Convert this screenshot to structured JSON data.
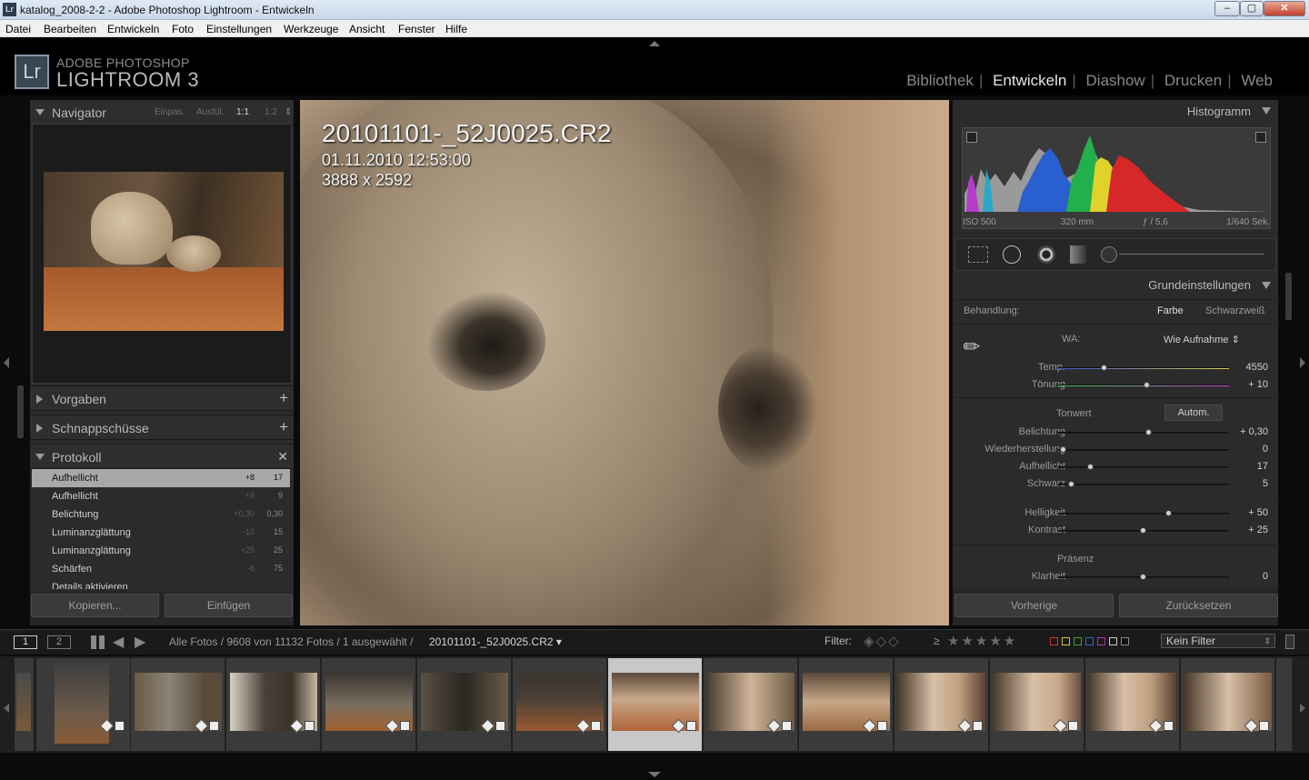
{
  "window": {
    "title": "katalog_2008-2-2 - Adobe Photoshop Lightroom - Entwickeln",
    "app_icon": "Lr"
  },
  "menu": [
    "Datei",
    "Bearbeiten",
    "Entwickeln",
    "Foto",
    "Einstellungen",
    "Werkzeuge",
    "Ansicht",
    "Fenster",
    "Hilfe"
  ],
  "brand": {
    "logo": "Lr",
    "line1": "ADOBE PHOTOSHOP",
    "line2": "LIGHTROOM 3"
  },
  "modules": [
    "Bibliothek",
    "Entwickeln",
    "Diashow",
    "Drucken",
    "Web"
  ],
  "active_module": "Entwickeln",
  "left": {
    "navigator": {
      "title": "Navigator",
      "zoom": [
        "Einpas.",
        "Ausfül.",
        "1:1",
        "1:2"
      ]
    },
    "vorgaben": "Vorgaben",
    "schnappschuesse": "Schnappschüsse",
    "protokoll": {
      "title": "Protokoll",
      "rows": [
        {
          "name": "Aufhellicht",
          "a": "+8",
          "b": "17"
        },
        {
          "name": "Aufhellicht",
          "a": "+9",
          "b": "9"
        },
        {
          "name": "Belichtung",
          "a": "+0,30",
          "b": "0,30"
        },
        {
          "name": "Luminanzglättung",
          "a": "-10",
          "b": "15"
        },
        {
          "name": "Luminanzglättung",
          "a": "+25",
          "b": "25"
        },
        {
          "name": "Schärfen",
          "a": "-6",
          "b": "75"
        },
        {
          "name": "Details aktivieren",
          "a": "",
          "b": ""
        }
      ]
    },
    "buttons": {
      "copy": "Kopieren...",
      "paste": "Einfügen"
    }
  },
  "photo": {
    "filename": "20101101-_52J0025.CR2",
    "datetime": "01.11.2010 12:53:00",
    "dims": "3888 x 2592"
  },
  "right": {
    "histogram": {
      "title": "Histogramm",
      "iso": "ISO 500",
      "focal": "320 mm",
      "aperture": "ƒ / 5,6",
      "shutter": "1/640 Sek."
    },
    "grund": "Grundeinstellungen",
    "behandlung": {
      "label": "Behandlung:",
      "farbe": "Farbe",
      "sw": "Schwarzweiß"
    },
    "wa": {
      "label": "WA:",
      "value": "Wie Aufnahme ⇕"
    },
    "temp": {
      "label": "Temp.",
      "value": "4550",
      "pos": 0.27
    },
    "toenung": {
      "label": "Tönung",
      "value": "+ 10",
      "pos": 0.52
    },
    "tonwert": {
      "label": "Tonwert",
      "auto": "Autom."
    },
    "belichtung": {
      "label": "Belichtung",
      "value": "+ 0,30",
      "pos": 0.53
    },
    "wieder": {
      "label": "Wiederherstellung",
      "value": "0",
      "pos": 0.03
    },
    "aufhell": {
      "label": "Aufhellicht",
      "value": "17",
      "pos": 0.19
    },
    "schwarz": {
      "label": "Schwarz",
      "value": "5",
      "pos": 0.08
    },
    "helligkeit": {
      "label": "Helligkeit",
      "value": "+ 50",
      "pos": 0.65
    },
    "kontrast": {
      "label": "Kontrast",
      "value": "+ 25",
      "pos": 0.5
    },
    "praesenz": {
      "label": "Präsenz"
    },
    "klarheit": {
      "label": "Klarheit",
      "value": "0",
      "pos": 0.5
    },
    "buttons": {
      "prev": "Vorherige",
      "reset": "Zurücksetzen"
    }
  },
  "filmbar": {
    "page1": "1",
    "page2": "2",
    "source": "Alle Fotos / 9608 von 11132 Fotos / 1 ausgewählt /",
    "file": "20101101-_52J0025.CR2 ▾",
    "filter_label": "Filter:",
    "rating_op": "≥",
    "stars": "★★★★★",
    "filter_value": "Kein Filter"
  },
  "colors": {
    "accent": "#e6e6e6",
    "panel": "#2b2b2b"
  }
}
